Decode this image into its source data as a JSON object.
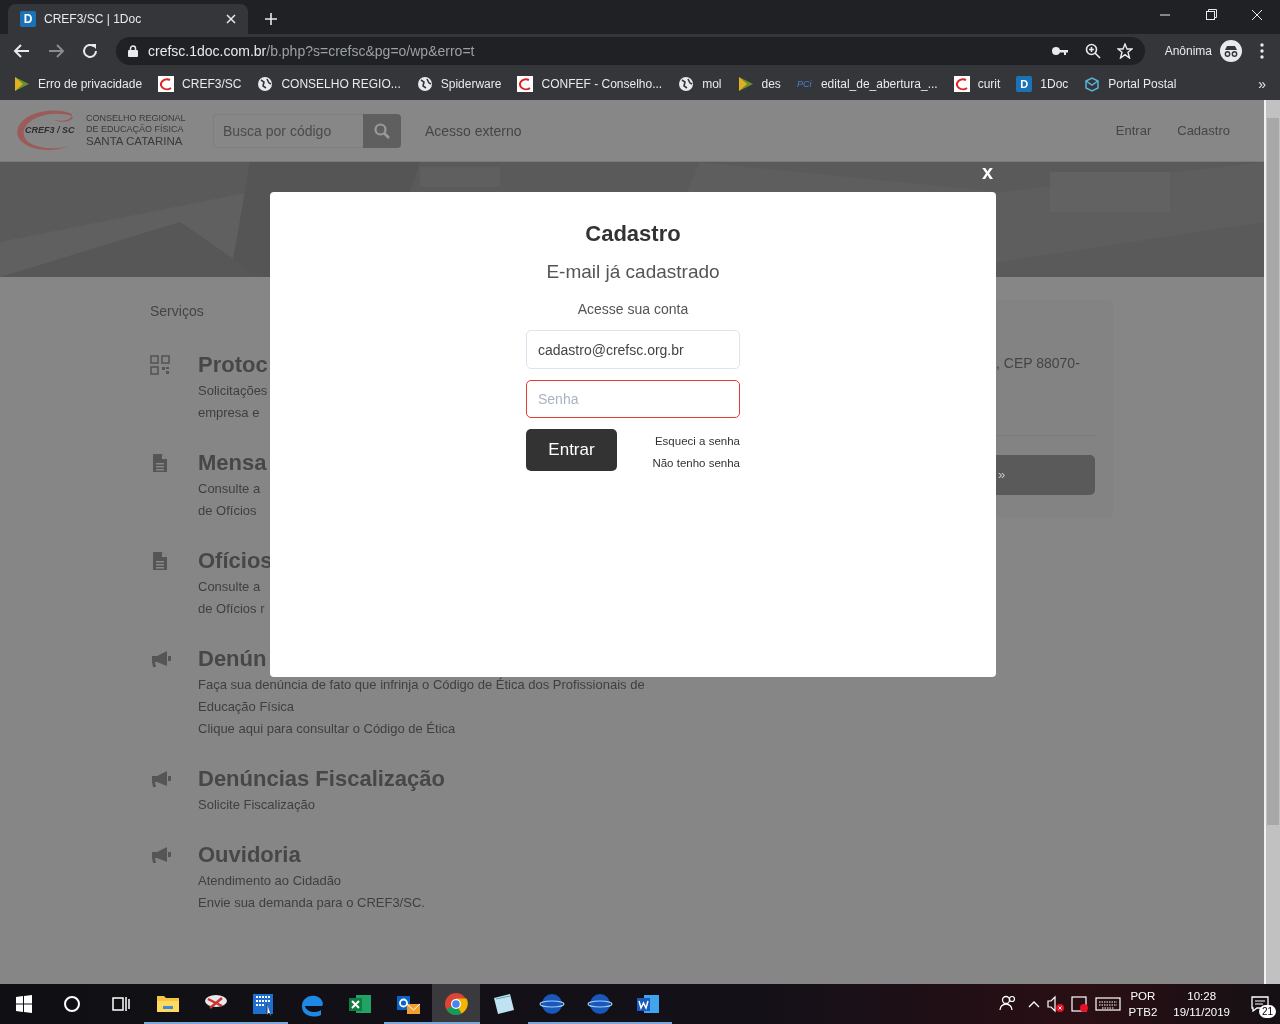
{
  "browser": {
    "tab": {
      "icon_text": "D",
      "title": "CREF3/SC | 1Doc",
      "selected": true
    },
    "address": {
      "host": "crefsc.1doc.com.br",
      "path": "/b.php?s=crefsc&pg=o/wp&erro=t"
    },
    "profile": "Anônima",
    "bookmarks": [
      {
        "kind": "flag",
        "label": "Erro de privacidade"
      },
      {
        "kind": "cref",
        "label": "CREF3/SC"
      },
      {
        "kind": "globe",
        "label": "CONSELHO REGIO..."
      },
      {
        "kind": "globe",
        "label": "Spiderware"
      },
      {
        "kind": "cref",
        "label": "CONFEF - Conselho..."
      },
      {
        "kind": "globe",
        "label": "mol"
      },
      {
        "kind": "flag",
        "label": "des"
      },
      {
        "kind": "pci",
        "icon_text": "PCi",
        "label": "edital_de_abertura_..."
      },
      {
        "kind": "cref",
        "label": "curit"
      },
      {
        "kind": "doc",
        "icon_text": "D",
        "label": "1Doc"
      },
      {
        "kind": "portal",
        "label": "Portal Postal"
      }
    ],
    "more": "»"
  },
  "header": {
    "logo": {
      "badge": "CREF3 / SC",
      "lines": [
        "CONSELHO REGIONAL",
        "DE EDUCAÇÃO FÍSICA",
        "SANTA CATARINA"
      ]
    },
    "search": {
      "placeholder": "Busca por código"
    },
    "external_link": "Acesso externo",
    "nav": [
      "Entrar",
      "Cadastro"
    ]
  },
  "services": {
    "heading": "Serviços",
    "items": [
      {
        "kind": "qr",
        "title": "Protoc",
        "lines": [
          "Solicitações",
          "empresa e"
        ]
      },
      {
        "kind": "file",
        "title": "Mensa",
        "lines": [
          "Consulte a",
          "de Ofícios"
        ]
      },
      {
        "kind": "file",
        "title": "Ofícios",
        "lines": [
          "Consulte a",
          "de Ofícios r"
        ]
      },
      {
        "kind": "megaphone",
        "title": "Denún",
        "lines": [
          "Faça sua denúncia de fato que infrinja o Código de Ética dos Profissionais de",
          "Educação Física",
          "Clique aqui para consultar o Código de Ética"
        ]
      },
      {
        "kind": "megaphone",
        "title": "Denúncias Fiscalização",
        "lines": [
          "Solicite Fiscalização"
        ]
      },
      {
        "kind": "megaphone",
        "title": "Ouvidoria",
        "lines": [
          "Atendimento ao Cidadão",
          "Envie sua demanda para o CREF3/SC."
        ]
      }
    ]
  },
  "side_card": {
    "text": ", CEP 88070-",
    "button": "»"
  },
  "modal": {
    "close": "x",
    "title": "Cadastro",
    "subtitle": "E-mail já cadastrado",
    "prompt": "Acesse sua conta",
    "email": {
      "value": "cadastro@crefsc.org.br",
      "error": false
    },
    "password": {
      "placeholder": "Senha",
      "error": true
    },
    "submit": "Entrar",
    "links": [
      "Esqueci a senha",
      "Não tenho senha"
    ]
  },
  "taskbar": {
    "apps": [
      {
        "kind": "folder",
        "running": true,
        "selected": false
      },
      {
        "kind": "scissors",
        "running": true,
        "selected": false
      },
      {
        "kind": "grid",
        "running": true,
        "selected": false
      },
      {
        "kind": "edge",
        "running": false,
        "selected": false
      },
      {
        "kind": "excel",
        "running": false,
        "selected": false
      },
      {
        "kind": "outlook",
        "running": true,
        "selected": false
      },
      {
        "kind": "chrome",
        "running": true,
        "selected": true
      },
      {
        "kind": "notepad",
        "running": false,
        "selected": false
      },
      {
        "kind": "spv",
        "running": true,
        "selected": false
      },
      {
        "kind": "spv",
        "running": true,
        "selected": false
      },
      {
        "kind": "word",
        "running": true,
        "selected": false
      }
    ],
    "language": [
      "POR",
      "PTB2"
    ],
    "time": "10:28",
    "date": "19/11/2019",
    "notifications": "21"
  }
}
